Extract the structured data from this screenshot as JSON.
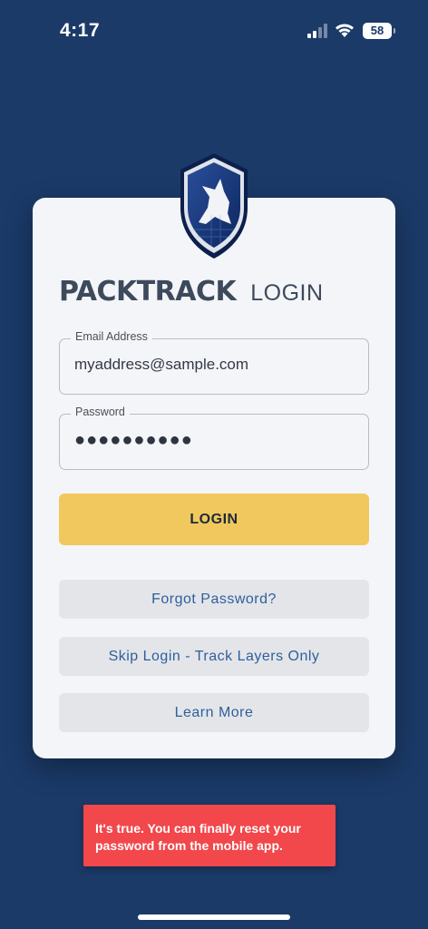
{
  "status_bar": {
    "time": "4:17",
    "battery": "58"
  },
  "brand": {
    "name": "PACKTRACK",
    "title": "LOGIN"
  },
  "form": {
    "email_label": "Email Address",
    "email_value": "myaddress@sample.com",
    "password_label": "Password",
    "password_masked": "●●●●●●●●●●"
  },
  "buttons": {
    "login": "LOGIN",
    "forgot": "Forgot Password?",
    "skip": "Skip Login - Track Layers Only",
    "learn_more": "Learn More"
  },
  "toast": {
    "line1": "It's true. You can finally reset your",
    "line2": "password from the mobile app."
  },
  "colors": {
    "background": "#1b3a68",
    "card": "#f4f5f9",
    "login_button": "#f0c85d",
    "secondary_button": "#e3e5e9",
    "link_text": "#2f5f9c",
    "toast": "#f2474b"
  },
  "icons": [
    "signal-icon",
    "wifi-icon",
    "battery-icon",
    "shield-wolf-logo-icon"
  ]
}
